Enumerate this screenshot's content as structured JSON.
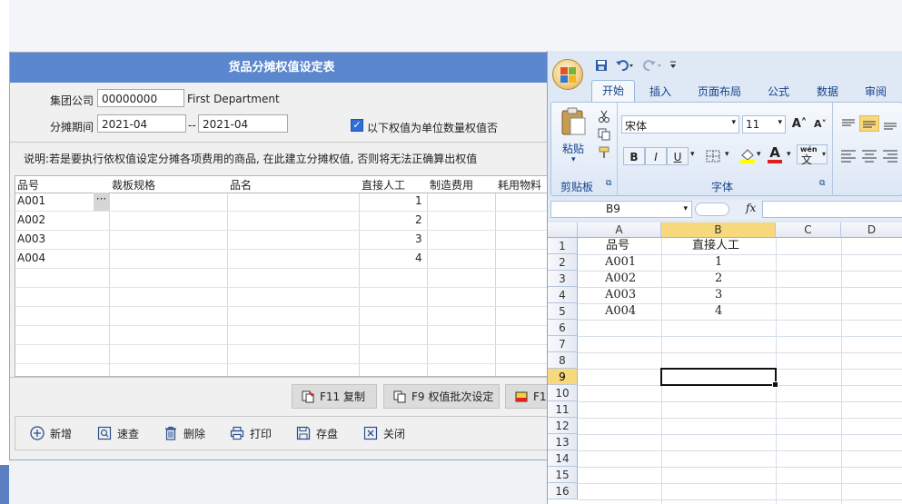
{
  "form": {
    "title": "货品分摊权值设定表",
    "group_label": "集团公司",
    "group_code": "00000000",
    "group_name": "First Department",
    "period_label": "分摊期间",
    "period_from": "2021-04",
    "period_sep": "--",
    "period_to": "2021-04",
    "checkbox_label": "以下权值为单位数量权值否",
    "checkbox_checked": true,
    "notice": "说明:若是要执行依权值设定分摊各项费用的商品,  在此建立分摊权值, 否则将无法正确算出权值",
    "grid": {
      "columns": [
        "品号",
        "裁板规格",
        "品名",
        "直接人工",
        "制造费用",
        "耗用物料"
      ],
      "rows": [
        {
          "code": "A001",
          "labor": "1"
        },
        {
          "code": "A002",
          "labor": "2"
        },
        {
          "code": "A003",
          "labor": "3"
        },
        {
          "code": "A004",
          "labor": "4"
        }
      ],
      "ellipsis": "···"
    },
    "buttons": {
      "copy": "F11 复制",
      "batch": "F9 权值批次设定",
      "partial": "F1"
    },
    "toolbar": {
      "add": "新增",
      "search": "速查",
      "delete": "删除",
      "print": "打印",
      "save": "存盘",
      "close": "关闭"
    }
  },
  "excel": {
    "tabs": [
      "开始",
      "插入",
      "页面布局",
      "公式",
      "数据",
      "审阅"
    ],
    "clipboard_label": "剪贴板",
    "paste_label": "粘贴",
    "font_group_label": "字体",
    "font_name": "宋体",
    "font_size": "11",
    "grow_font": "A",
    "shrink_font": "A",
    "bold": "B",
    "italic": "I",
    "underline": "U",
    "font_color": "A",
    "wen": "wén",
    "wen_char": "文",
    "name_box": "B9",
    "fx": "fx",
    "columns": [
      "A",
      "B",
      "C",
      "D"
    ],
    "row_numbers": [
      "1",
      "2",
      "3",
      "4",
      "5",
      "6",
      "7",
      "8",
      "9",
      "10",
      "11",
      "12",
      "13",
      "14",
      "15",
      "16"
    ],
    "cells": {
      "a1": "品号",
      "b1": "直接人工",
      "a2": "A001",
      "b2": "1",
      "a3": "A002",
      "b3": "2",
      "a4": "A003",
      "b4": "3",
      "a5": "A004",
      "b5": "4"
    },
    "colors": {
      "ribbon_text": "#15428b",
      "selected_header": "#f8d87c"
    }
  }
}
